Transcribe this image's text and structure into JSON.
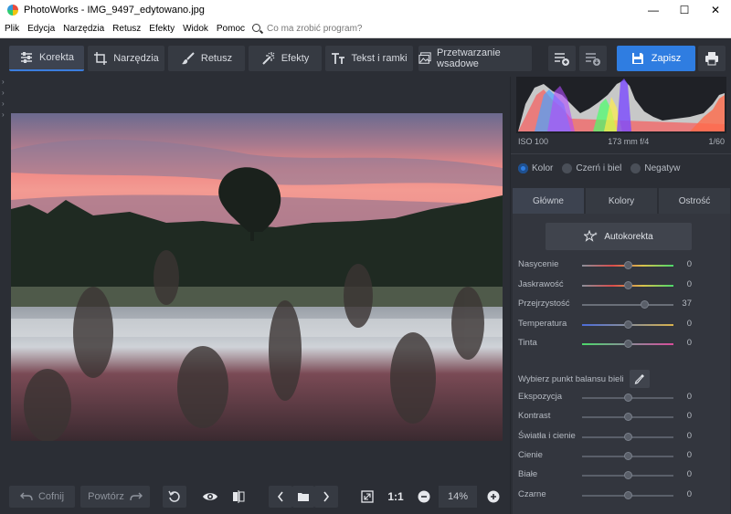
{
  "window": {
    "title": "PhotoWorks - IMG_9497_edytowano.jpg",
    "controls": [
      "—",
      "☐",
      "✕"
    ]
  },
  "menu": {
    "items": [
      "Plik",
      "Edycja",
      "Narzędzia",
      "Retusz",
      "Efekty",
      "Widok",
      "Pomoc"
    ],
    "search_placeholder": "Co ma zrobić program?"
  },
  "toolbar": {
    "tabs": [
      {
        "label": "Korekta",
        "icon": "sliders-icon"
      },
      {
        "label": "Narzędzia",
        "icon": "crop-icon"
      },
      {
        "label": "Retusz",
        "icon": "brush-icon"
      },
      {
        "label": "Efekty",
        "icon": "magic-wand-icon"
      },
      {
        "label": "Tekst i ramki",
        "icon": "text-icon"
      }
    ],
    "batch_label": "Przetwarzanie wsadowe",
    "save_label": "Zapisz",
    "accent": "#2f7de1"
  },
  "bottom": {
    "undo_label": "Cofnij",
    "redo_label": "Powtórz",
    "zoom_label": "1:1",
    "zoom_value": "14%"
  },
  "panel": {
    "exif": {
      "iso": "ISO 100",
      "lens": "173 mm f/4",
      "shutter": "1/60"
    },
    "modes": [
      "Kolor",
      "Czerń i biel",
      "Negatyw"
    ],
    "subtabs": [
      "Główne",
      "Kolory",
      "Ostrość"
    ],
    "autocorrect_label": "Autokorekta",
    "wb_label": "Wybierz punkt balansu bieli",
    "sliders": [
      {
        "label": "Nasycenie",
        "value": "0",
        "pos": 0.5,
        "track": "sat"
      },
      {
        "label": "Jaskrawość",
        "value": "0",
        "pos": 0.5,
        "track": "sat"
      },
      {
        "label": "Przejrzystość",
        "value": "37",
        "pos": 0.68,
        "track": "gray"
      },
      {
        "label": "Temperatura",
        "value": "0",
        "pos": 0.5,
        "track": "temp"
      },
      {
        "label": "Tinta",
        "value": "0",
        "pos": 0.5,
        "track": "tint"
      }
    ],
    "sliders2": [
      {
        "label": "Ekspozycja",
        "value": "0",
        "pos": 0.5
      },
      {
        "label": "Kontrast",
        "value": "0",
        "pos": 0.5
      },
      {
        "label": "Światła i cienie",
        "value": "0",
        "pos": 0.5
      },
      {
        "label": "Cienie",
        "value": "0",
        "pos": 0.5
      },
      {
        "label": "Białe",
        "value": "0",
        "pos": 0.5
      },
      {
        "label": "Czarne",
        "value": "0",
        "pos": 0.5
      }
    ]
  }
}
